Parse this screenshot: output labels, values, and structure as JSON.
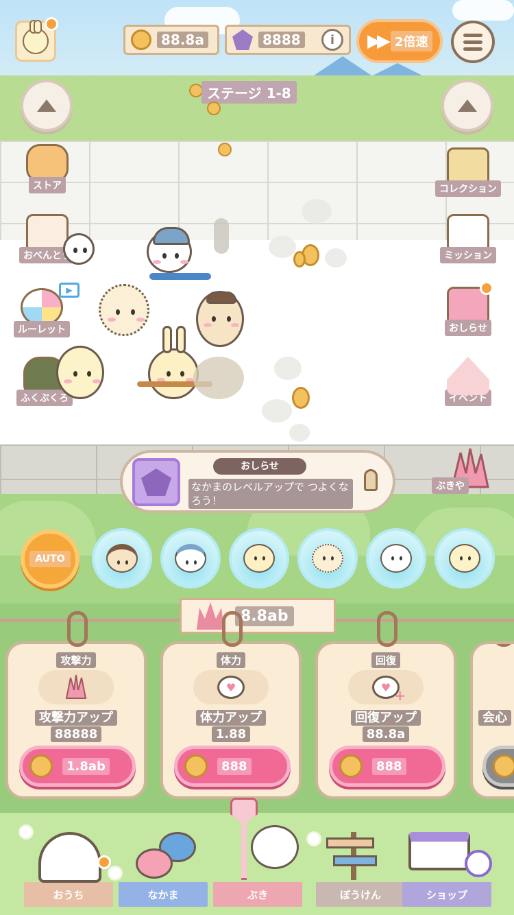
{
  "top_bar": {
    "coins": {
      "value": "88.8a"
    },
    "gems": {
      "value": "8888"
    },
    "info_symbol": "i",
    "speed": {
      "label": "2倍速"
    }
  },
  "stage": {
    "label": "ステージ 1-8"
  },
  "left_menu": [
    {
      "label": "ストア"
    },
    {
      "label": "おべんとう"
    },
    {
      "label": "ルーレット"
    },
    {
      "label": "ふくぶくろ"
    }
  ],
  "right_menu": [
    {
      "label": "コレクション"
    },
    {
      "label": "ミッション"
    },
    {
      "label": "おしらせ"
    },
    {
      "label": "イベント"
    }
  ],
  "notice": {
    "title": "おしらせ",
    "text": "なかまのレベルアップで つよくなろう！"
  },
  "weapon_shop": {
    "label": "ぶきや"
  },
  "auto_button": {
    "label": "AUTO"
  },
  "shelf": {
    "power_value": "8.8ab"
  },
  "cards": [
    {
      "title": "攻撃力",
      "icon": "claw-icon",
      "desc_line1": "攻撃力アップ",
      "desc_line2": "88888",
      "price": "1.8ab"
    },
    {
      "title": "体力",
      "icon": "heart-face-icon",
      "desc_line1": "体力アップ",
      "desc_line2": "1.88",
      "price": "888"
    },
    {
      "title": "回復",
      "icon": "heart-plus-icon",
      "desc_line1": "回復アップ",
      "desc_line2": "88.8a",
      "price": "888"
    },
    {
      "title": "会心",
      "icon": "locked",
      "desc_line1": "会心",
      "desc_line2": "",
      "price": ""
    }
  ],
  "bottom_nav": [
    {
      "label": "おうち",
      "color": "#e6bfa6"
    },
    {
      "label": "なかま",
      "color": "#94b2e6"
    },
    {
      "label": "ぶき",
      "color": "#eda7b0"
    },
    {
      "label": "ぼうけん",
      "color": "#c9b8b1"
    },
    {
      "label": "ショップ",
      "color": "#b0a6dc"
    }
  ],
  "colors": {
    "accent_orange": "#f79a3a",
    "buy_pink": "#f16a96",
    "party_cyan": "#8fe0ef",
    "grass": "#a8d98a"
  }
}
